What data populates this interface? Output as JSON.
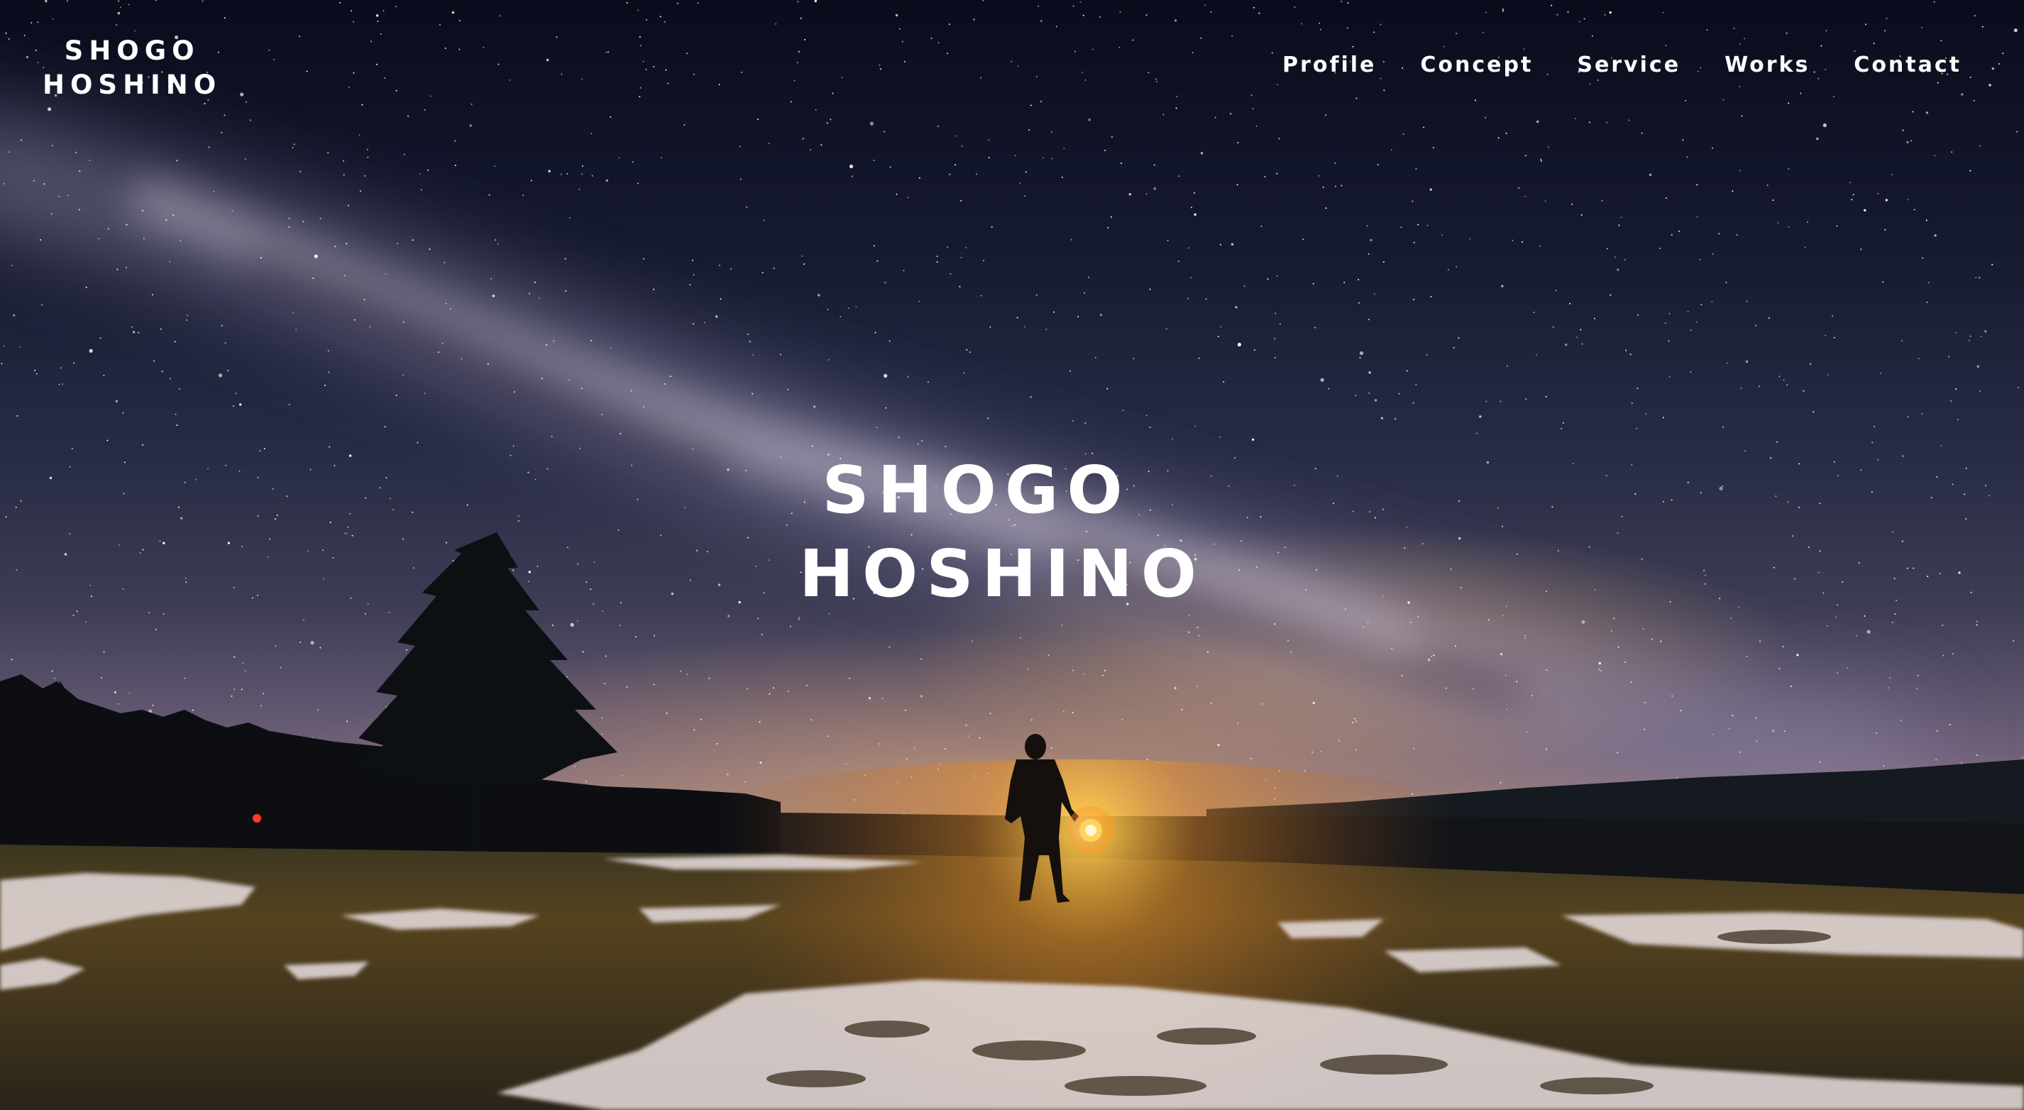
{
  "header": {
    "logo": {
      "line1": "SHOGO",
      "line2": "HOSHINO"
    },
    "nav": [
      {
        "label": "Profile"
      },
      {
        "label": "Concept"
      },
      {
        "label": "Service"
      },
      {
        "label": "Works"
      },
      {
        "label": "Contact"
      }
    ]
  },
  "hero": {
    "title_line1": "SHOGO",
    "title_line2": "HOSHINO",
    "background": {
      "image_subject": "starry night sky with milky way, person holding lantern in snowy field",
      "sky_color": "#161a30",
      "horizon_color": "#d9ab7a",
      "lantern_color": "#ffb327"
    }
  }
}
